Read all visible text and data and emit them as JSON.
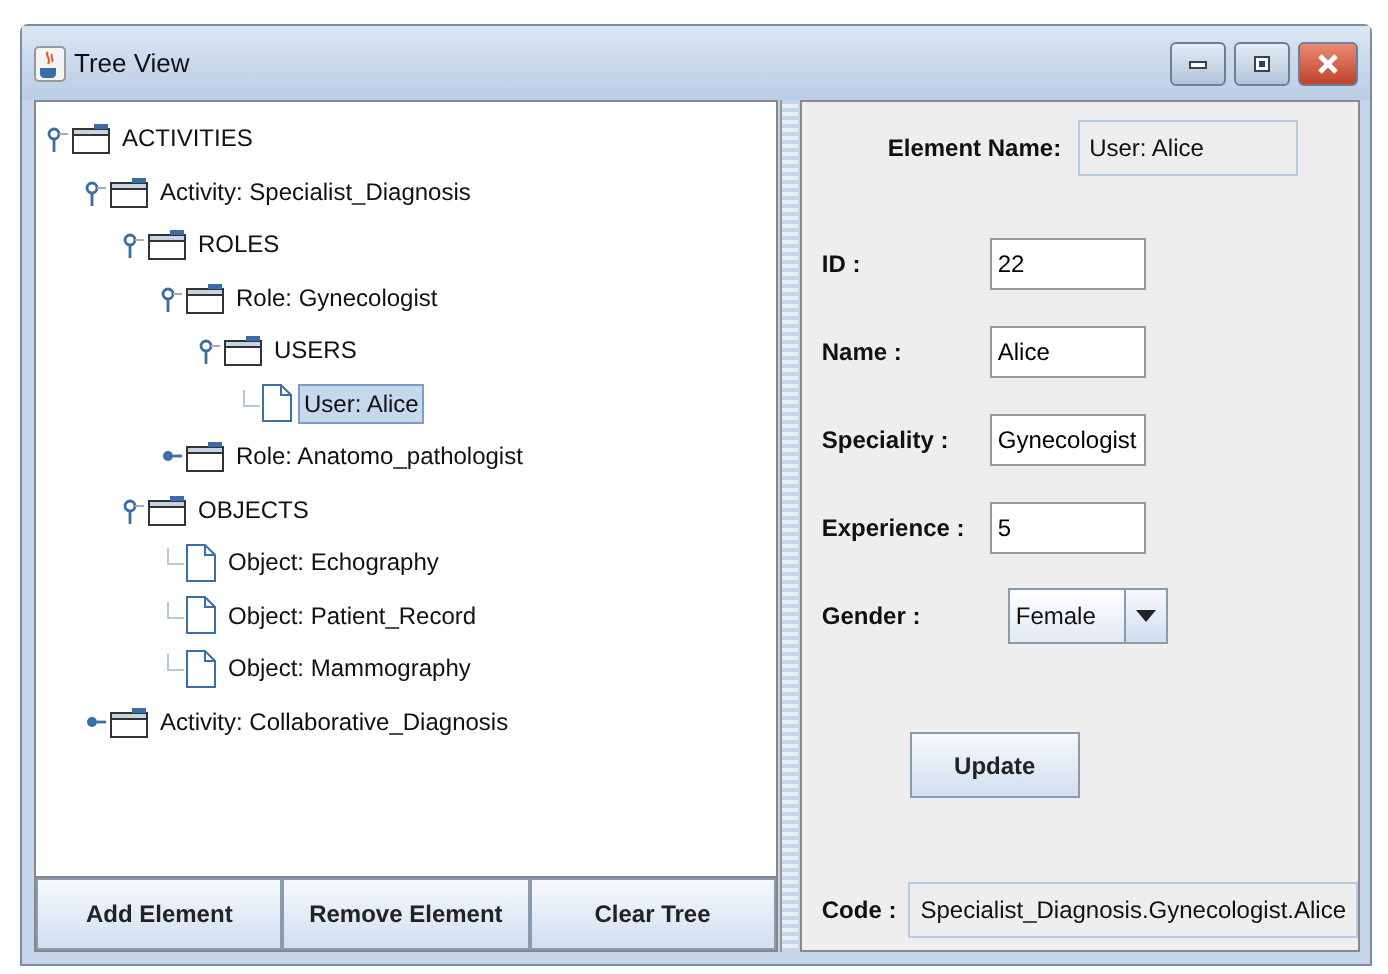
{
  "window": {
    "title": "Tree View"
  },
  "tree": [
    {
      "label": "ACTIVITIES",
      "kind": "folder",
      "expanded": true,
      "selected": false,
      "children": [
        {
          "label": "Activity: Specialist_Diagnosis",
          "kind": "folder",
          "expanded": true,
          "selected": false,
          "children": [
            {
              "label": "ROLES",
              "kind": "folder",
              "expanded": true,
              "selected": false,
              "children": [
                {
                  "label": "Role: Gynecologist",
                  "kind": "folder",
                  "expanded": true,
                  "selected": false,
                  "children": [
                    {
                      "label": "USERS",
                      "kind": "folder",
                      "expanded": true,
                      "selected": false,
                      "children": [
                        {
                          "label": "User: Alice",
                          "kind": "leaf",
                          "selected": true
                        }
                      ]
                    }
                  ]
                },
                {
                  "label": "Role: Anatomo_pathologist",
                  "kind": "folder",
                  "expanded": false,
                  "selected": false
                }
              ]
            },
            {
              "label": "OBJECTS",
              "kind": "folder",
              "expanded": true,
              "selected": false,
              "children": [
                {
                  "label": "Object: Echography",
                  "kind": "leaf",
                  "selected": false
                },
                {
                  "label": "Object: Patient_Record",
                  "kind": "leaf",
                  "selected": false
                },
                {
                  "label": "Object: Mammography",
                  "kind": "leaf",
                  "selected": false
                }
              ]
            }
          ]
        },
        {
          "label": "Activity: Collaborative_Diagnosis",
          "kind": "folder",
          "expanded": false,
          "selected": false
        }
      ]
    }
  ],
  "buttons": [
    "Add Element",
    "Remove Element",
    "Clear Tree"
  ],
  "element_name": {
    "label": "Element Name:",
    "value": "User: Alice"
  },
  "fields": [
    {
      "label": "ID :",
      "kind": "text",
      "value": "22"
    },
    {
      "label": "Name :",
      "kind": "text",
      "value": "Alice"
    },
    {
      "label": "Speciality :",
      "kind": "text",
      "value": "Gynecologist"
    },
    {
      "label": "Experience :",
      "kind": "text",
      "value": "5"
    },
    {
      "label": "Gender :",
      "kind": "dropdown",
      "value": "Female"
    }
  ],
  "update_button": "Update",
  "code": {
    "label": "Code :",
    "value": "Specialist_Diagnosis.Gynecologist.Alice"
  }
}
